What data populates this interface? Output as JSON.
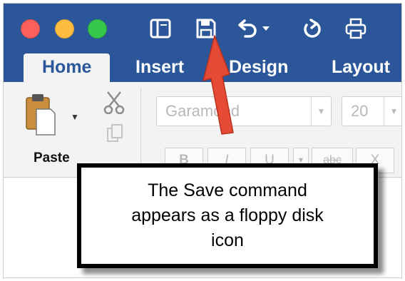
{
  "window": {
    "controls": [
      "close",
      "minimize",
      "zoom"
    ],
    "colors": {
      "close": "#fc605c",
      "minimize": "#fdbc40",
      "zoom": "#34c84a",
      "brand": "#2b579a"
    }
  },
  "quick_access": {
    "icons": [
      "sidebar-icon",
      "save-floppy-disk-icon",
      "undo-icon",
      "undo-dropdown-chevron-icon",
      "redo-icon",
      "print-icon"
    ]
  },
  "tabs": [
    {
      "label": "Home",
      "active": true
    },
    {
      "label": "Insert"
    },
    {
      "label": "Design"
    },
    {
      "label": "Layout"
    }
  ],
  "ribbon": {
    "paste_label": "Paste",
    "font_name": "Garamond",
    "font_size": "20",
    "format_buttons": [
      "B",
      "I",
      "U",
      "abc",
      "X"
    ]
  },
  "callout": {
    "line1": "The Save command",
    "line2": "appears as a floppy disk",
    "line3": "icon"
  }
}
